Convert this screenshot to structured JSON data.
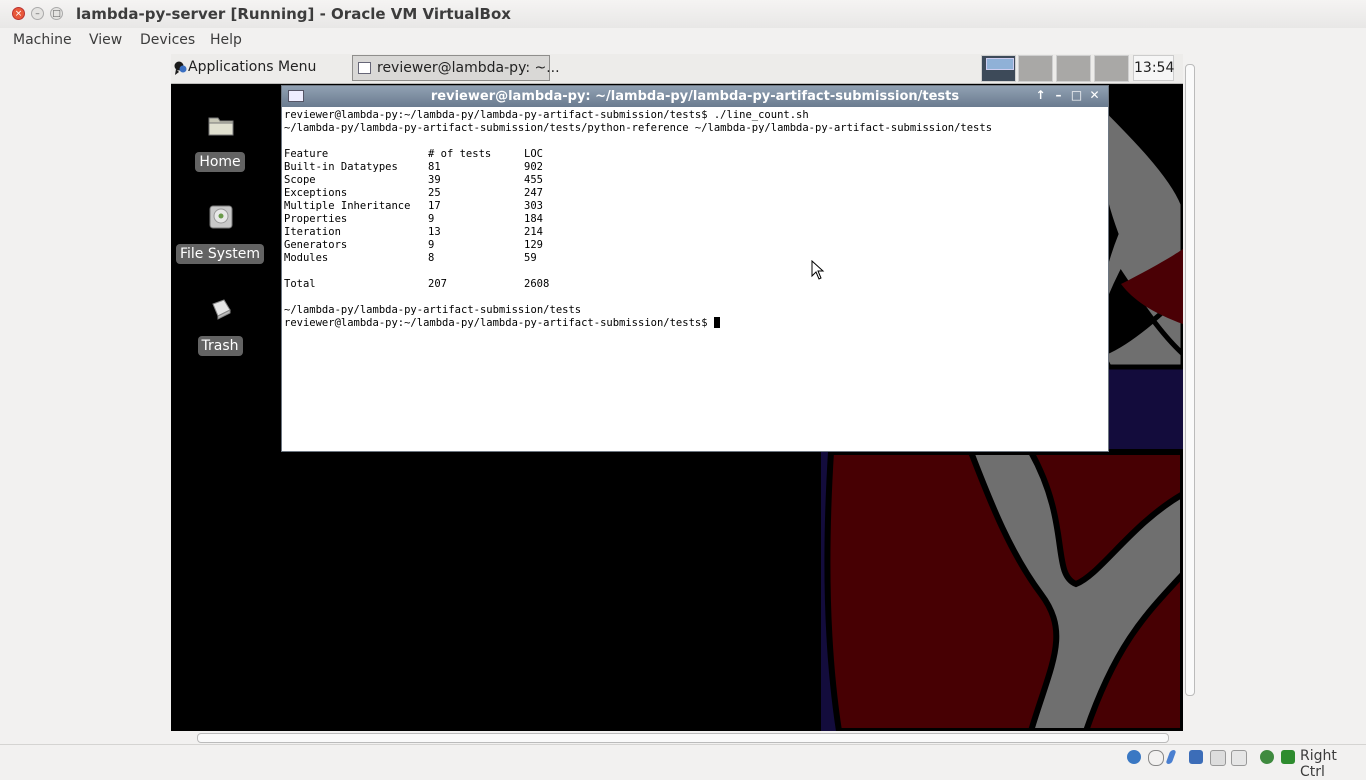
{
  "window": {
    "title": "lambda-py-server [Running] - Oracle VM VirtualBox"
  },
  "menubar": [
    "Machine",
    "View",
    "Devices",
    "Help"
  ],
  "guest_panel": {
    "applications_menu": "Applications Menu",
    "task_button": "reviewer@lambda-py: ~...",
    "clock": "13:54"
  },
  "desktop_icons": {
    "home": "Home",
    "file_system": "File System",
    "trash": "Trash"
  },
  "terminal": {
    "title": "reviewer@lambda-py: ~/lambda-py/lambda-py-artifact-submission/tests",
    "line1": "reviewer@lambda-py:~/lambda-py/lambda-py-artifact-submission/tests$ ./line_count.sh",
    "line2": "~/lambda-py/lambda-py-artifact-submission/tests/python-reference ~/lambda-py/lambda-py-artifact-submission/tests",
    "headers": [
      "Feature",
      "# of tests",
      "LOC"
    ],
    "rows": [
      [
        "Built-in Datatypes",
        "81",
        "902"
      ],
      [
        "Scope",
        "39",
        "455"
      ],
      [
        "Exceptions",
        "25",
        "247"
      ],
      [
        "Multiple Inheritance",
        "17",
        "303"
      ],
      [
        "Properties",
        "9",
        "184"
      ],
      [
        "Iteration",
        "13",
        "214"
      ],
      [
        "Generators",
        "9",
        "129"
      ],
      [
        "Modules",
        "8",
        "59"
      ]
    ],
    "total": [
      "Total",
      "207",
      "2608"
    ],
    "line_after": "~/lambda-py/lambda-py-artifact-submission/tests",
    "prompt": "reviewer@lambda-py:~/lambda-py/lambda-py-artifact-submission/tests$ "
  },
  "statusbar": {
    "host_key": "Right Ctrl"
  }
}
